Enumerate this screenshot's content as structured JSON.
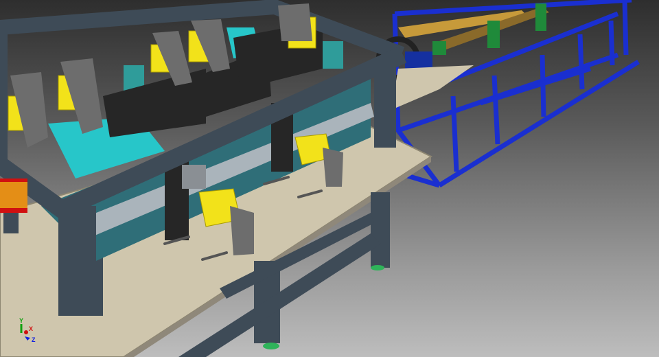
{
  "viewport": {
    "background_top": "#2e2e2e",
    "background_bottom": "#bdbdbd"
  },
  "colors": {
    "plate": "#cfc6ad",
    "frame": "#3e4b57",
    "blue_conveyor": "#1a2fd0",
    "motor_yellow": "#f2e21a",
    "motor_gray": "#6d6d6d",
    "cyan_block": "#27c6c9",
    "teal_part": "#2f9c9a",
    "black_plate": "#262626",
    "foot_green": "#2fb35a"
  },
  "triad": {
    "x_label": "X",
    "y_label": "Y",
    "z_label": "Z",
    "x_color": "#d01010",
    "y_color": "#10a010",
    "z_color": "#1020e0"
  }
}
